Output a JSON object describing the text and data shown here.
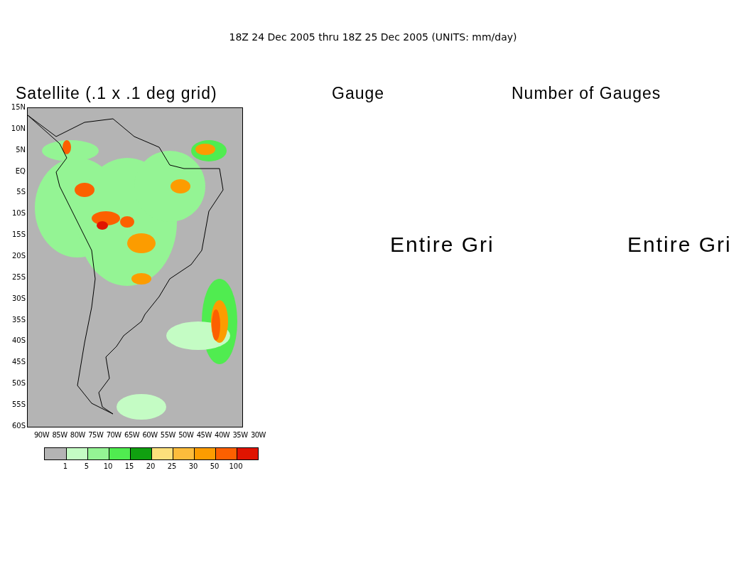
{
  "title": "18Z 24 Dec 2005 thru 18Z 25 Dec 2005 (UNITS: mm/day)",
  "panels": [
    {
      "kind": "map",
      "heading": "Satellite (.1 x .1 deg grid)",
      "lat_labels": [
        "15N",
        "10N",
        "5N",
        "EQ",
        "5S",
        "10S",
        "15S",
        "20S",
        "25S",
        "30S",
        "35S",
        "40S",
        "45S",
        "50S",
        "55S",
        "60S"
      ],
      "lon_labels": [
        "90W",
        "85W",
        "80W",
        "75W",
        "70W",
        "65W",
        "60W",
        "55W",
        "50W",
        "45W",
        "40W",
        "35W",
        "30W"
      ],
      "colorbar": {
        "bins": [
          {
            "color": "#b4b4b4"
          },
          {
            "color": "#c4fcc4"
          },
          {
            "color": "#94f494"
          },
          {
            "color": "#50ec50"
          },
          {
            "color": "#10a010"
          },
          {
            "color": "#fce07c"
          },
          {
            "color": "#fcbc3c"
          },
          {
            "color": "#fc9c00"
          },
          {
            "color": "#fc6000"
          },
          {
            "color": "#e01400"
          }
        ],
        "labels": [
          "1",
          "5",
          "10",
          "15",
          "20",
          "25",
          "30",
          "50",
          "100"
        ]
      }
    },
    {
      "kind": "message",
      "heading": "Gauge",
      "message": "Entire Gri"
    },
    {
      "kind": "message",
      "heading": "Number of Gauges",
      "message": "Entire Gri"
    }
  ]
}
